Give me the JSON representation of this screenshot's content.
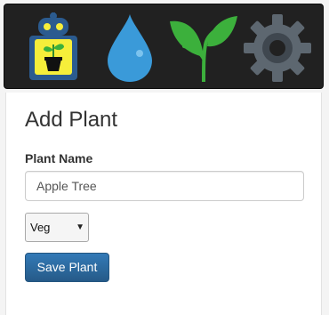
{
  "navbar": {
    "icons": [
      {
        "name": "robot-plant-icon",
        "label": "Home"
      },
      {
        "name": "water-drop-icon",
        "label": "Water"
      },
      {
        "name": "sprout-icon",
        "label": "Plants"
      },
      {
        "name": "gear-icon",
        "label": "Settings"
      }
    ],
    "colors": {
      "background": "#212121",
      "robot_yellow": "#f6ee3a",
      "robot_blue": "#2b5b8f",
      "water_blue": "#3a9ad9",
      "sprout_green": "#3cb03c",
      "gear_gray": "#5d6770"
    }
  },
  "form": {
    "title": "Add Plant",
    "plant_name_label": "Plant Name",
    "plant_name_value": "Apple Tree",
    "type_selected": "Veg",
    "save_label": "Save Plant"
  },
  "colors": {
    "primary_button": "#2e6da4"
  }
}
